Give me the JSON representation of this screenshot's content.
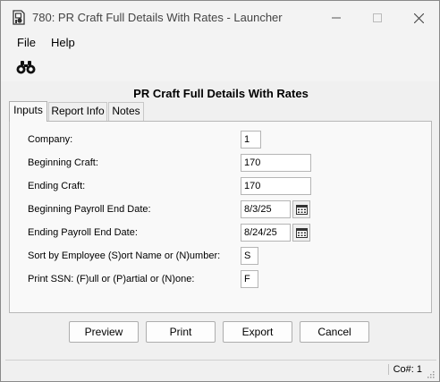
{
  "window": {
    "title": "780: PR Craft Full Details With Rates - Launcher"
  },
  "titlebar_icons": {
    "app": "report-launcher-icon",
    "minimize": "minimize-icon",
    "maximize": "maximize-icon",
    "close": "close-icon"
  },
  "menu": {
    "file": "File",
    "help": "Help"
  },
  "toolbar": {
    "find_icon": "binoculars-icon"
  },
  "report_title": "PR Craft Full Details With Rates",
  "tabs": [
    {
      "label": "Inputs",
      "active": true
    },
    {
      "label": "Report Info",
      "active": false
    },
    {
      "label": "Notes",
      "active": false
    }
  ],
  "fields": {
    "company": {
      "label": "Company:",
      "value": "1"
    },
    "beginning_craft": {
      "label": "Beginning Craft:",
      "value": "170"
    },
    "ending_craft": {
      "label": "Ending Craft:",
      "value": "170"
    },
    "beginning_payroll_end_date": {
      "label": "Beginning Payroll End Date:",
      "value": "8/3/25"
    },
    "ending_payroll_end_date": {
      "label": "Ending Payroll End Date:",
      "value": "8/24/25"
    },
    "sort_by": {
      "label": "Sort by Employee (S)ort Name or (N)umber:",
      "value": "S"
    },
    "print_ssn": {
      "label": "Print SSN: (F)ull or (P)artial or (N)one:",
      "value": "F"
    }
  },
  "buttons": {
    "preview": "Preview",
    "print": "Print",
    "export": "Export",
    "cancel": "Cancel"
  },
  "status": {
    "company": "Co#: 1"
  }
}
